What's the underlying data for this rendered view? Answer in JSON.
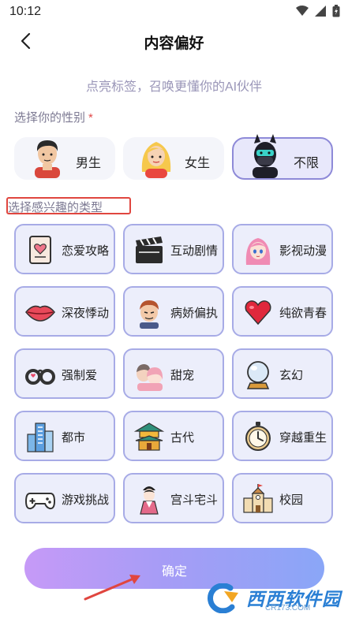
{
  "status_bar": {
    "time": "10:12"
  },
  "header": {
    "title": "内容偏好"
  },
  "subtitle": "点亮标签，召唤更懂你的AI伙伴",
  "gender": {
    "label": "选择你的性别",
    "required_mark": "*",
    "options": [
      {
        "label": "男生",
        "selected": false
      },
      {
        "label": "女生",
        "selected": false
      },
      {
        "label": "不限",
        "selected": true
      }
    ]
  },
  "interests": {
    "label": "选择感兴趣的类型",
    "tags": [
      {
        "label": "恋爱攻略",
        "icon": "love-diary-icon"
      },
      {
        "label": "互动剧情",
        "icon": "clapperboard-icon"
      },
      {
        "label": "影视动漫",
        "icon": "anime-girl-icon"
      },
      {
        "label": "深夜悸动",
        "icon": "lips-icon"
      },
      {
        "label": "病娇偏执",
        "icon": "sinister-boy-icon"
      },
      {
        "label": "纯欲青春",
        "icon": "heart-icon"
      },
      {
        "label": "强制爱",
        "icon": "handcuffs-icon"
      },
      {
        "label": "甜宠",
        "icon": "couple-icon"
      },
      {
        "label": "玄幻",
        "icon": "crystal-ball-icon"
      },
      {
        "label": "都市",
        "icon": "city-buildings-icon"
      },
      {
        "label": "古代",
        "icon": "pagoda-icon"
      },
      {
        "label": "穿越重生",
        "icon": "stopwatch-icon"
      },
      {
        "label": "游戏挑战",
        "icon": "gamepad-icon"
      },
      {
        "label": "宫斗宅斗",
        "icon": "palace-lady-icon"
      },
      {
        "label": "校园",
        "icon": "school-building-icon"
      }
    ]
  },
  "confirm": {
    "label": "确定"
  },
  "watermark": {
    "text": "西西软件园",
    "url": "CR173.COM"
  },
  "colors": {
    "accent": "#a7abe6",
    "selected_border": "#8e8ad8",
    "required": "#e24b4b",
    "button_gradient_start": "#c69af7",
    "button_gradient_end": "#8aa6f7"
  }
}
